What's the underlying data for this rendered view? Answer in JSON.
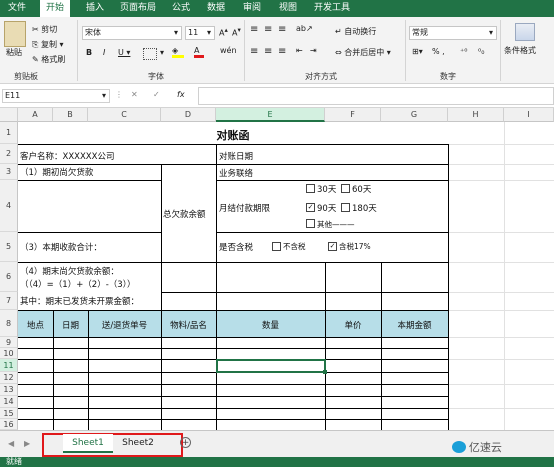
{
  "menu": {
    "items": [
      "文件",
      "开始",
      "插入",
      "页面布局",
      "公式",
      "数据",
      "审阅",
      "视图",
      "开发工具"
    ]
  },
  "ribbon": {
    "paste_label": "粘贴",
    "cut_label": "剪切",
    "copy_label": "复制 ▾",
    "format_painter_label": "格式刷",
    "clipboard_group": "剪贴板",
    "font_name": "宋体",
    "font_size": "11",
    "bold": "B",
    "italic": "I",
    "underline": "U ▾",
    "font_group": "字体",
    "wrap_text": "自动换行",
    "merge_center": "合并后居中 ▾",
    "alignment_group": "对齐方式",
    "number_format": "常规",
    "percent": "% ,",
    "number_group": "数字",
    "conditional_format": "条件格式"
  },
  "formula_bar": {
    "name_box": "E11",
    "fx": "fx"
  },
  "columns": [
    "A",
    "B",
    "C",
    "D",
    "E",
    "F",
    "G",
    "H",
    "I"
  ],
  "rows": [
    "1",
    "2",
    "3",
    "4",
    "5",
    "6",
    "7",
    "8",
    "9",
    "10",
    "11",
    "12",
    "13",
    "14",
    "15",
    "16"
  ],
  "sheet": {
    "title": "对账函",
    "customer": "客户名称：XXXXXX公司",
    "date": "对账日期",
    "opening": "（1）期初尚欠货款",
    "business": "业务联络",
    "total_due": "总欠款余额",
    "d30": "30天",
    "d60": "60天",
    "d90": "90天",
    "d180": "180天",
    "other": "其他———",
    "monthly_terms": "月结付款期限",
    "period_receipts": "（3）本期收款合计：",
    "tax_included": "是否含税",
    "no_tax": "不含税",
    "tax17": "含税17%",
    "closing": "（4）期末尚欠货款余额：",
    "formula": "（（4）=（1）+（2）-（3））",
    "uninvoiced": "其中：期末已发货未开票金额：",
    "headers": [
      "地点",
      "日期",
      "送/退货单号",
      "物料/品名",
      "数量",
      "单价",
      "本期金额"
    ]
  },
  "tabs": {
    "sheet1": "Sheet1",
    "sheet2": "Sheet2",
    "add": "+"
  },
  "status": {
    "ready": "就绪"
  },
  "watermark": "亿速云",
  "colors": {
    "accent": "#217346",
    "header_fill": "#b7dee8",
    "highlight": "#e0191b"
  }
}
